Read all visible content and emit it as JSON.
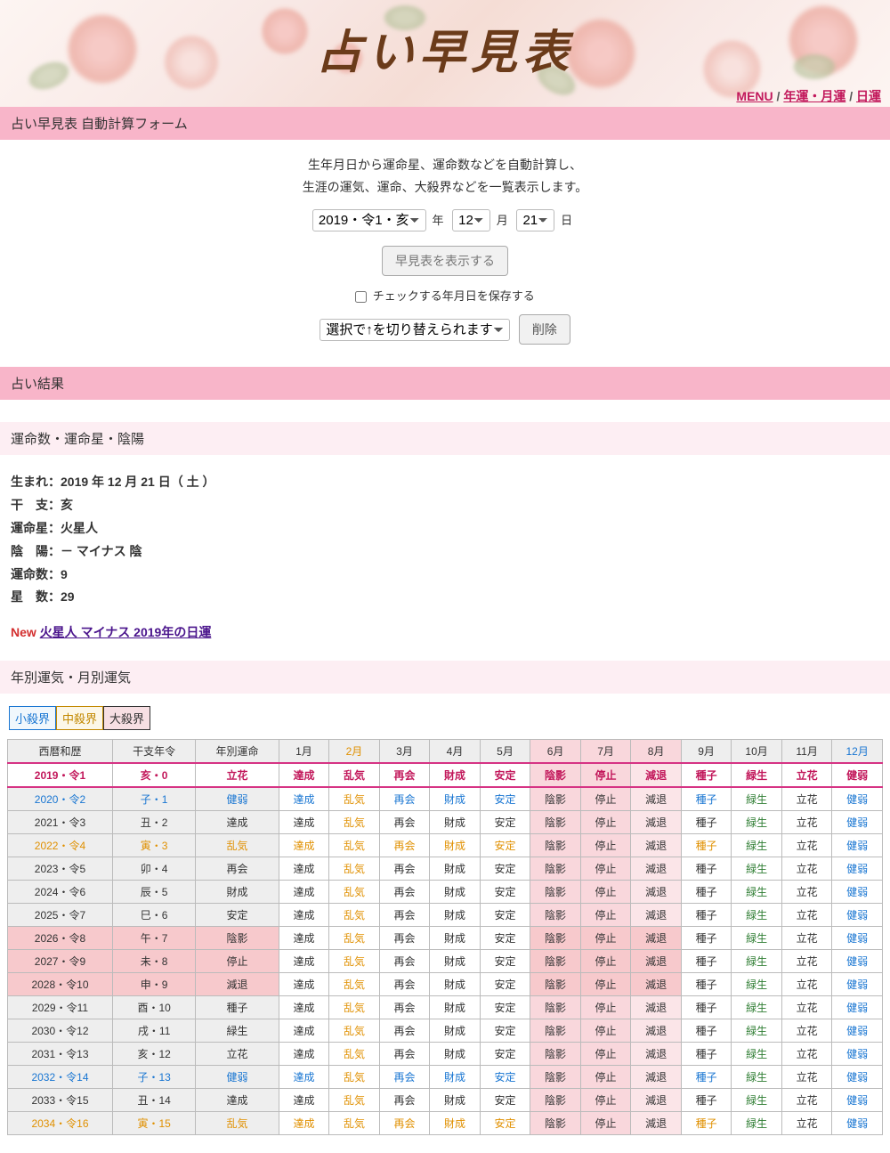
{
  "header": {
    "title": "占い早見表"
  },
  "nav": {
    "menu": "MENU",
    "link1": "年運・月運",
    "link2": "日運",
    "sep": " / "
  },
  "form_section": {
    "title": "占い早見表 自動計算フォーム"
  },
  "form": {
    "intro1": "生年月日から運命星、運命数などを自動計算し、",
    "intro2": "生涯の運気、運命、大殺界などを一覧表示します。",
    "year_sel": "2019・令1・亥",
    "year_lbl": "年",
    "month_sel": "12",
    "month_lbl": "月",
    "day_sel": "21",
    "day_lbl": "日",
    "show_btn": "早見表を表示する",
    "save_chk": "チェックする年月日を保存する",
    "switch_sel": "選択で↑を切り替えられます",
    "del_btn": "削除"
  },
  "result_section": {
    "title": "占い結果"
  },
  "sub_section": {
    "title": "運命数・運命星・陰陽"
  },
  "result": {
    "l1": "生まれ：2019 年 12 月 21 日（ 土 ）",
    "l2": "干　支：亥",
    "l3": "運命星：火星人",
    "l4": "陰　陽：－ マイナス 陰",
    "l5": "運命数：9",
    "l6": "星　数：29",
    "new": "New",
    "new_link": "火星人 マイナス 2019年の日運"
  },
  "table_section": {
    "title": "年別運気・月別運気"
  },
  "legend": {
    "small": "小殺界",
    "mid": "中殺界",
    "big": "大殺界"
  },
  "headers": {
    "h1": "西暦和歴",
    "h2": "干支年令",
    "h3": "年別運命",
    "m1": "1月",
    "m2": "2月",
    "m3": "3月",
    "m4": "4月",
    "m5": "5月",
    "m6": "6月",
    "m7": "7月",
    "m8": "8月",
    "m9": "9月",
    "m10": "10月",
    "m11": "11月",
    "m12": "12月"
  },
  "months_vals": {
    "v1": "達成",
    "v2": "乱気",
    "v3": "再会",
    "v4": "財成",
    "v5": "安定",
    "v6": "陰影",
    "v7": "停止",
    "v8": "減退",
    "v9": "種子",
    "v10": "緑生",
    "v11": "立花",
    "v12": "健弱"
  },
  "rows": [
    {
      "y": "2019・令1",
      "t": "亥・0",
      "u": "立花",
      "hl": true,
      "blue": false,
      "orange": false,
      "bgR": false
    },
    {
      "y": "2020・令2",
      "t": "子・1",
      "u": "健弱",
      "hl": false,
      "blue": true,
      "orange": false,
      "bgR": false
    },
    {
      "y": "2021・令3",
      "t": "丑・2",
      "u": "達成",
      "hl": false,
      "blue": false,
      "orange": false,
      "bgR": false
    },
    {
      "y": "2022・令4",
      "t": "寅・3",
      "u": "乱気",
      "hl": false,
      "blue": false,
      "orange": true,
      "bgR": false
    },
    {
      "y": "2023・令5",
      "t": "卯・4",
      "u": "再会",
      "hl": false,
      "blue": false,
      "orange": false,
      "bgR": false
    },
    {
      "y": "2024・令6",
      "t": "辰・5",
      "u": "財成",
      "hl": false,
      "blue": false,
      "orange": false,
      "bgR": false
    },
    {
      "y": "2025・令7",
      "t": "巳・6",
      "u": "安定",
      "hl": false,
      "blue": false,
      "orange": false,
      "bgR": false
    },
    {
      "y": "2026・令8",
      "t": "午・7",
      "u": "陰影",
      "hl": false,
      "blue": false,
      "orange": false,
      "bgR": true
    },
    {
      "y": "2027・令9",
      "t": "未・8",
      "u": "停止",
      "hl": false,
      "blue": false,
      "orange": false,
      "bgR": true
    },
    {
      "y": "2028・令10",
      "t": "申・9",
      "u": "減退",
      "hl": false,
      "blue": false,
      "orange": false,
      "bgR": true
    },
    {
      "y": "2029・令11",
      "t": "酉・10",
      "u": "種子",
      "hl": false,
      "blue": false,
      "orange": false,
      "bgR": false
    },
    {
      "y": "2030・令12",
      "t": "戌・11",
      "u": "緑生",
      "hl": false,
      "blue": false,
      "orange": false,
      "bgR": false
    },
    {
      "y": "2031・令13",
      "t": "亥・12",
      "u": "立花",
      "hl": false,
      "blue": false,
      "orange": false,
      "bgR": false
    },
    {
      "y": "2032・令14",
      "t": "子・13",
      "u": "健弱",
      "hl": false,
      "blue": true,
      "orange": false,
      "bgR": false
    },
    {
      "y": "2033・令15",
      "t": "丑・14",
      "u": "達成",
      "hl": false,
      "blue": false,
      "orange": false,
      "bgR": false
    },
    {
      "y": "2034・令16",
      "t": "寅・15",
      "u": "乱気",
      "hl": false,
      "blue": false,
      "orange": true,
      "bgR": false
    }
  ]
}
